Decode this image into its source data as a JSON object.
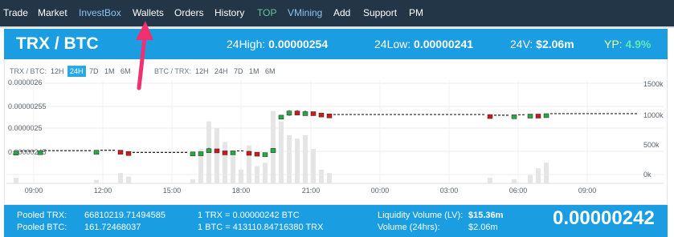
{
  "nav": {
    "items": [
      {
        "label": "Trade",
        "color": "white"
      },
      {
        "label": "Market",
        "color": "white"
      },
      {
        "label": "InvestBox",
        "color": "blue"
      },
      {
        "label": "Wallets",
        "color": "white"
      },
      {
        "label": "Orders",
        "color": "white"
      },
      {
        "label": "History",
        "color": "white"
      },
      {
        "label": "TOP",
        "color": "green"
      },
      {
        "label": "VMining",
        "color": "blue"
      },
      {
        "label": "Add",
        "color": "white"
      },
      {
        "label": "Support",
        "color": "white"
      },
      {
        "label": "PM",
        "color": "white"
      }
    ]
  },
  "header": {
    "pair": "TRX / BTC",
    "high_label": "24High:",
    "high_value": "0.00000254",
    "low_label": "24Low:",
    "low_value": "0.00000241",
    "vol_label": "24V:",
    "vol_value": "$2.06m",
    "yp_label": "YP:",
    "yp_value": "4.9%"
  },
  "chart_controls": {
    "left_label": "TRX / BTC:",
    "right_label": "BTC / TRX:",
    "timeframes": [
      "12H",
      "24H",
      "7D",
      "1M",
      "6M"
    ],
    "active": "24H"
  },
  "chart_data": {
    "type": "candlestick",
    "price_ticks": [
      "0.0000026",
      "0.00000255",
      "0.0000025",
      "0.00000245"
    ],
    "volume_ticks": [
      "1500k",
      "1000k",
      "500k",
      "0k"
    ],
    "x_ticks": [
      "09:00",
      "12:00",
      "15:00",
      "18:00",
      "21:00",
      "00:00",
      "03:00",
      "06:00",
      "09:00"
    ],
    "candles": [
      {
        "o": 2.442,
        "c": 2.446,
        "h": 2.447,
        "l": 2.441,
        "v": 80
      },
      {
        "o": 2.446,
        "c": 2.446,
        "h": 2.446,
        "l": 2.446,
        "v": 0
      },
      {
        "o": 2.446,
        "c": 2.446,
        "h": 2.446,
        "l": 2.446,
        "v": 0
      },
      {
        "o": 2.446,
        "c": 2.447,
        "h": 2.447,
        "l": 2.446,
        "v": 0
      },
      {
        "o": 2.447,
        "c": 2.447,
        "h": 2.447,
        "l": 2.447,
        "v": 0
      },
      {
        "o": 2.447,
        "c": 2.447,
        "h": 2.447,
        "l": 2.447,
        "v": 0
      },
      {
        "o": 2.447,
        "c": 2.447,
        "h": 2.447,
        "l": 2.447,
        "v": 0
      },
      {
        "o": 2.447,
        "c": 2.447,
        "h": 2.447,
        "l": 2.447,
        "v": 0
      },
      {
        "o": 2.447,
        "c": 2.447,
        "h": 2.447,
        "l": 2.447,
        "v": 0
      },
      {
        "o": 2.447,
        "c": 2.447,
        "h": 2.447,
        "l": 2.447,
        "v": 0
      },
      {
        "o": 2.447,
        "c": 2.448,
        "h": 2.448,
        "l": 2.447,
        "v": 50
      },
      {
        "o": 2.448,
        "c": 2.448,
        "h": 2.448,
        "l": 2.448,
        "v": 0
      },
      {
        "o": 2.448,
        "c": 2.448,
        "h": 2.448,
        "l": 2.448,
        "v": 0
      },
      {
        "o": 2.448,
        "c": 2.445,
        "h": 2.448,
        "l": 2.445,
        "v": 150
      },
      {
        "o": 2.445,
        "c": 2.443,
        "h": 2.445,
        "l": 2.443,
        "v": 100
      },
      {
        "o": 2.443,
        "c": 2.443,
        "h": 2.443,
        "l": 2.443,
        "v": 0
      },
      {
        "o": 2.443,
        "c": 2.443,
        "h": 2.443,
        "l": 2.443,
        "v": 0
      },
      {
        "o": 2.443,
        "c": 2.443,
        "h": 2.443,
        "l": 2.443,
        "v": 0
      },
      {
        "o": 2.443,
        "c": 2.443,
        "h": 2.443,
        "l": 2.443,
        "v": 0
      },
      {
        "o": 2.443,
        "c": 2.443,
        "h": 2.443,
        "l": 2.443,
        "v": 0
      },
      {
        "o": 2.443,
        "c": 2.443,
        "h": 2.443,
        "l": 2.443,
        "v": 0
      },
      {
        "o": 2.443,
        "c": 2.443,
        "h": 2.443,
        "l": 2.443,
        "v": 0
      },
      {
        "o": 2.443,
        "c": 2.444,
        "h": 2.444,
        "l": 2.443,
        "v": 60
      },
      {
        "o": 2.444,
        "c": 2.4445,
        "h": 2.445,
        "l": 2.442,
        "v": 500
      },
      {
        "o": 2.4445,
        "c": 2.4515,
        "h": 2.4535,
        "l": 2.442,
        "v": 900
      },
      {
        "o": 2.451,
        "c": 2.4465,
        "h": 2.451,
        "l": 2.4445,
        "v": 800
      },
      {
        "o": 2.4465,
        "c": 2.4445,
        "h": 2.4465,
        "l": 2.4445,
        "v": 600
      },
      {
        "o": 2.4455,
        "c": 2.4465,
        "h": 2.4465,
        "l": 2.4445,
        "v": 400
      },
      {
        "o": 2.4465,
        "c": 2.4465,
        "h": 2.4465,
        "l": 2.4465,
        "v": 200
      },
      {
        "o": 2.4455,
        "c": 2.4435,
        "h": 2.4465,
        "l": 2.4435,
        "v": 550
      },
      {
        "o": 2.4435,
        "c": 2.4425,
        "h": 2.4435,
        "l": 2.442,
        "v": 250
      },
      {
        "o": 2.442,
        "c": 2.4425,
        "h": 2.4425,
        "l": 2.442,
        "v": 300
      },
      {
        "o": 2.4425,
        "c": 2.452,
        "h": 2.453,
        "l": 2.442,
        "v": 1050
      },
      {
        "o": 2.5255,
        "c": 2.5275,
        "h": 2.528,
        "l": 2.525,
        "v": 900
      },
      {
        "o": 2.5275,
        "c": 2.537,
        "h": 2.539,
        "l": 2.526,
        "v": 700
      },
      {
        "o": 2.537,
        "c": 2.5345,
        "h": 2.539,
        "l": 2.534,
        "v": 650
      },
      {
        "o": 2.5345,
        "c": 2.5355,
        "h": 2.5385,
        "l": 2.534,
        "v": 700
      },
      {
        "o": 2.5355,
        "c": 2.5325,
        "h": 2.5355,
        "l": 2.532,
        "v": 500
      },
      {
        "o": 2.5325,
        "c": 2.5305,
        "h": 2.5325,
        "l": 2.53,
        "v": 200
      },
      {
        "o": 2.5305,
        "c": 2.5295,
        "h": 2.5305,
        "l": 2.529,
        "v": 150
      },
      {
        "o": 2.529,
        "c": 2.529,
        "h": 2.529,
        "l": 2.529,
        "v": 0
      },
      {
        "o": 2.529,
        "c": 2.529,
        "h": 2.529,
        "l": 2.529,
        "v": 0
      },
      {
        "o": 2.529,
        "c": 2.529,
        "h": 2.529,
        "l": 2.529,
        "v": 0
      },
      {
        "o": 2.529,
        "c": 2.529,
        "h": 2.529,
        "l": 2.529,
        "v": 0
      },
      {
        "o": 2.529,
        "c": 2.529,
        "h": 2.529,
        "l": 2.529,
        "v": 0
      },
      {
        "o": 2.529,
        "c": 2.529,
        "h": 2.529,
        "l": 2.529,
        "v": 0
      },
      {
        "o": 2.529,
        "c": 2.529,
        "h": 2.529,
        "l": 2.529,
        "v": 0
      },
      {
        "o": 2.529,
        "c": 2.529,
        "h": 2.529,
        "l": 2.529,
        "v": 0
      },
      {
        "o": 2.529,
        "c": 2.529,
        "h": 2.529,
        "l": 2.529,
        "v": 0
      },
      {
        "o": 2.529,
        "c": 2.529,
        "h": 2.529,
        "l": 2.529,
        "v": 0
      },
      {
        "o": 2.529,
        "c": 2.529,
        "h": 2.529,
        "l": 2.529,
        "v": 0
      },
      {
        "o": 2.529,
        "c": 2.529,
        "h": 2.529,
        "l": 2.529,
        "v": 0
      },
      {
        "o": 2.529,
        "c": 2.529,
        "h": 2.529,
        "l": 2.529,
        "v": 0
      },
      {
        "o": 2.529,
        "c": 2.529,
        "h": 2.529,
        "l": 2.529,
        "v": 0
      },
      {
        "o": 2.529,
        "c": 2.529,
        "h": 2.529,
        "l": 2.529,
        "v": 0
      },
      {
        "o": 2.529,
        "c": 2.529,
        "h": 2.529,
        "l": 2.529,
        "v": 0
      },
      {
        "o": 2.529,
        "c": 2.529,
        "h": 2.529,
        "l": 2.529,
        "v": 0
      },
      {
        "o": 2.529,
        "c": 2.529,
        "h": 2.529,
        "l": 2.529,
        "v": 0
      },
      {
        "o": 2.529,
        "c": 2.529,
        "h": 2.529,
        "l": 2.529,
        "v": 0
      },
      {
        "o": 2.529,
        "c": 2.5275,
        "h": 2.529,
        "l": 2.5275,
        "v": 80
      },
      {
        "o": 2.5275,
        "c": 2.5275,
        "h": 2.5275,
        "l": 2.5275,
        "v": 0
      },
      {
        "o": 2.5275,
        "c": 2.5275,
        "h": 2.5275,
        "l": 2.5275,
        "v": 0
      },
      {
        "o": 2.5275,
        "c": 2.5285,
        "h": 2.5285,
        "l": 2.5275,
        "v": 60
      },
      {
        "o": 2.5285,
        "c": 2.5285,
        "h": 2.5285,
        "l": 2.5285,
        "v": 0
      },
      {
        "o": 2.5285,
        "c": 2.53,
        "h": 2.53,
        "l": 2.5285,
        "v": 120
      },
      {
        "o": 2.53,
        "c": 2.5295,
        "h": 2.5305,
        "l": 2.5295,
        "v": 220
      },
      {
        "o": 2.5295,
        "c": 2.531,
        "h": 2.531,
        "l": 2.529,
        "v": 300
      },
      {
        "o": 2.531,
        "c": 2.531,
        "h": 2.531,
        "l": 2.531,
        "v": 0
      },
      {
        "o": 2.531,
        "c": 2.531,
        "h": 2.531,
        "l": 2.531,
        "v": 0
      },
      {
        "o": 2.531,
        "c": 2.531,
        "h": 2.531,
        "l": 2.531,
        "v": 0
      },
      {
        "o": 2.531,
        "c": 2.531,
        "h": 2.531,
        "l": 2.531,
        "v": 0
      },
      {
        "o": 2.531,
        "c": 2.531,
        "h": 2.531,
        "l": 2.531,
        "v": 0
      },
      {
        "o": 2.531,
        "c": 2.531,
        "h": 2.531,
        "l": 2.531,
        "v": 0
      },
      {
        "o": 2.531,
        "c": 2.531,
        "h": 2.531,
        "l": 2.531,
        "v": 0
      },
      {
        "o": 2.531,
        "c": 2.531,
        "h": 2.531,
        "l": 2.531,
        "v": 0
      },
      {
        "o": 2.531,
        "c": 2.531,
        "h": 2.531,
        "l": 2.531,
        "v": 0
      },
      {
        "o": 2.531,
        "c": 2.531,
        "h": 2.531,
        "l": 2.531,
        "v": 0
      },
      {
        "o": 2.531,
        "c": 2.531,
        "h": 2.531,
        "l": 2.531,
        "v": 0
      }
    ]
  },
  "footer": {
    "pooled_trx_label": "Pooled TRX:",
    "pooled_trx_value": "66810219.71494585",
    "pooled_btc_label": "Pooled BTC:",
    "pooled_btc_value": "161.72468037",
    "rate1": "1 TRX = 0.00000242 BTC",
    "rate2": "1 BTC = 413110.84716380 TRX",
    "lv_label": "Liquidity Volume (LV):",
    "lv_value": "$15.36m",
    "vol_label": "Volume (24hrs):",
    "vol_value": "$2.06m",
    "price": "0.00000242"
  },
  "colors": {
    "nav_bg": "#233647",
    "accent": "#1a9ee1",
    "up": "#27a842",
    "down": "#d0191c",
    "volume": "#e5e5e5"
  }
}
